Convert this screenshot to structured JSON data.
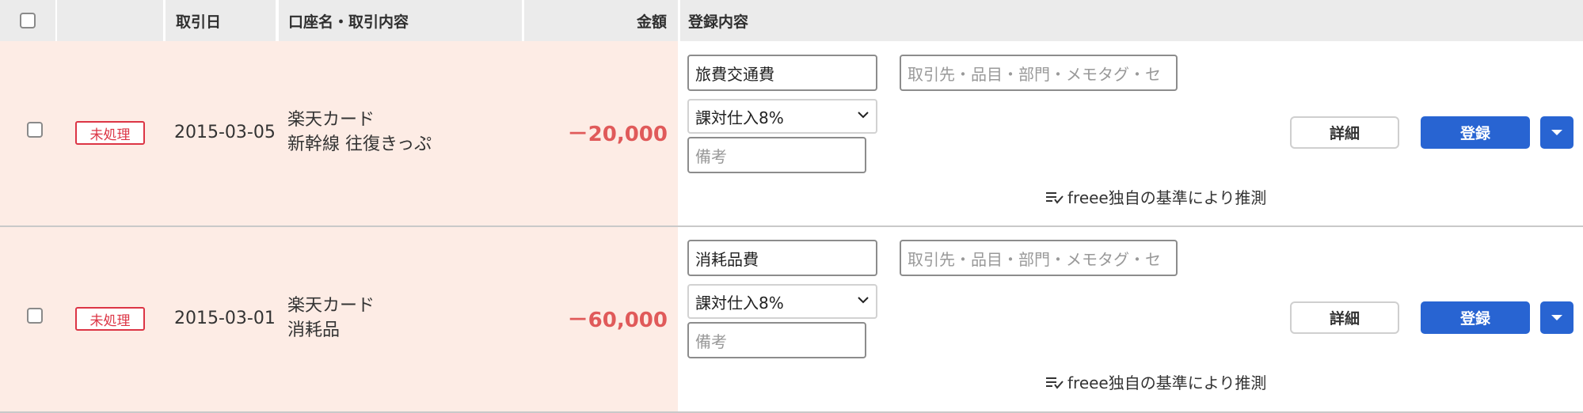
{
  "header": {
    "date_label": "取引日",
    "account_label": "口座名・取引内容",
    "amount_label": "金額",
    "register_label": "登録内容"
  },
  "rows": [
    {
      "status": "未処理",
      "date": "2015-03-05",
      "account_name": "楽天カード",
      "description": "新幹線 往復きっぷ",
      "amount": "－20,000",
      "category": "旅費交通費",
      "tag_placeholder": "取引先・品目・部門・メモタグ・セ",
      "tax": "課対仕入8%",
      "memo_placeholder": "備考",
      "hint": "freee独自の基準により推測",
      "detail_label": "詳細",
      "register_label": "登録"
    },
    {
      "status": "未処理",
      "date": "2015-03-01",
      "account_name": "楽天カード",
      "description": "消耗品",
      "amount": "－60,000",
      "category": "消耗品費",
      "tag_placeholder": "取引先・品目・部門・メモタグ・セ",
      "tax": "課対仕入8%",
      "memo_placeholder": "備考",
      "hint": "freee独自の基準により推測",
      "detail_label": "詳細",
      "register_label": "登録"
    }
  ],
  "colors": {
    "accent": "#2864d2",
    "unprocessed": "#dc3545",
    "amount_negative": "#e05a5a",
    "row_highlight": "#fdece5"
  }
}
